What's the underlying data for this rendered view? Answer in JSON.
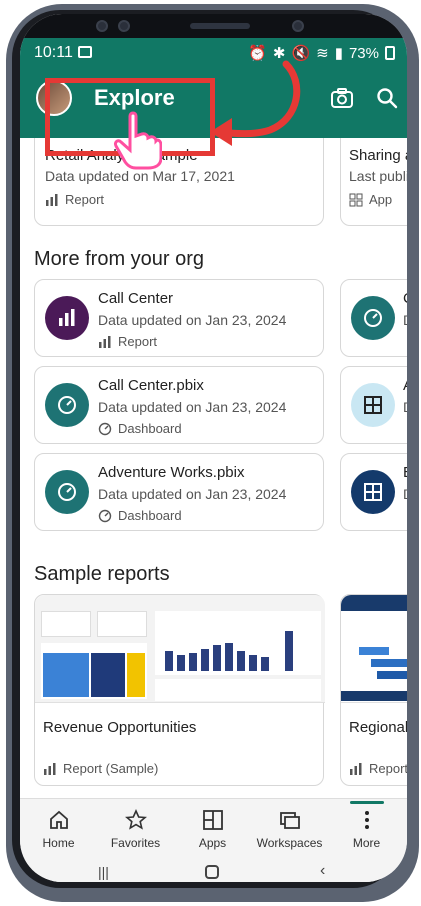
{
  "status": {
    "time": "10:11",
    "battery": "73%"
  },
  "header": {
    "title": "Explore"
  },
  "featured": [
    {
      "title": "Retail Analysis Sample",
      "subtitle": "Data updated on Mar 17, 2021",
      "type": "Report"
    },
    {
      "title": "Sharing ap",
      "subtitle": "Last publish",
      "type": "App"
    }
  ],
  "sections": {
    "more": "More from your org",
    "sample": "Sample reports"
  },
  "org_items": [
    {
      "title": "Call Center",
      "subtitle": "Data updated on Jan 23, 2024",
      "type": "Report",
      "icon": "report-icon"
    },
    {
      "title": "Call Center.pbix",
      "subtitle": "Data updated on Jan 23, 2024",
      "type": "Dashboard",
      "icon": "dashboard-icon"
    },
    {
      "title": "Adventure Works.pbix",
      "subtitle": "Data updated on Jan 23, 2024",
      "type": "Dashboard",
      "icon": "dashboard-icon"
    }
  ],
  "org_items_right": [
    {
      "title": "C",
      "subtitle": "D"
    },
    {
      "title": "A",
      "subtitle": "D"
    },
    {
      "title": "E",
      "subtitle": "D"
    }
  ],
  "samples": [
    {
      "title": "Revenue Opportunities",
      "type": "Report (Sample)"
    },
    {
      "title": "Regional S",
      "type": "Report ("
    }
  ],
  "bottom_nav": [
    {
      "label": "Home",
      "icon": "home-icon"
    },
    {
      "label": "Favorites",
      "icon": "star-icon"
    },
    {
      "label": "Apps",
      "icon": "apps-icon"
    },
    {
      "label": "Workspaces",
      "icon": "workspaces-icon"
    },
    {
      "label": "More",
      "icon": "more-icon"
    }
  ],
  "colors": {
    "brand": "#117865",
    "purple": "#4b1a58",
    "teal": "#1e7374",
    "highlight": "#e53935"
  }
}
